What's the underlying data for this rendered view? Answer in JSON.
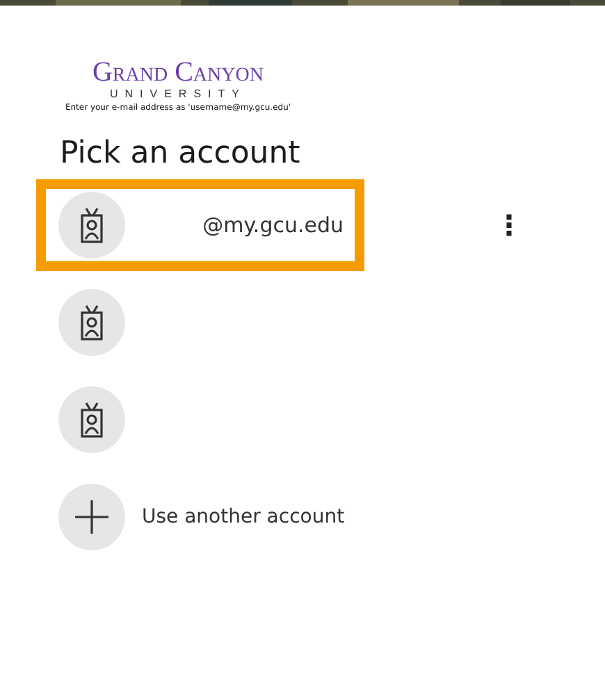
{
  "logo": {
    "name": "Grand Canyon",
    "subtitle": "UNIVERSITY",
    "hint": "Enter your e-mail address as 'username@my.gcu.edu'"
  },
  "title": "Pick an account",
  "accounts": [
    {
      "kind": "account",
      "email": "@my.gcu.edu",
      "highlighted": true,
      "menu": "⋮"
    },
    {
      "kind": "account",
      "highlighted": false
    },
    {
      "kind": "account",
      "highlighted": false
    },
    {
      "kind": "add",
      "label": "Use another account",
      "highlighted": false
    }
  ]
}
